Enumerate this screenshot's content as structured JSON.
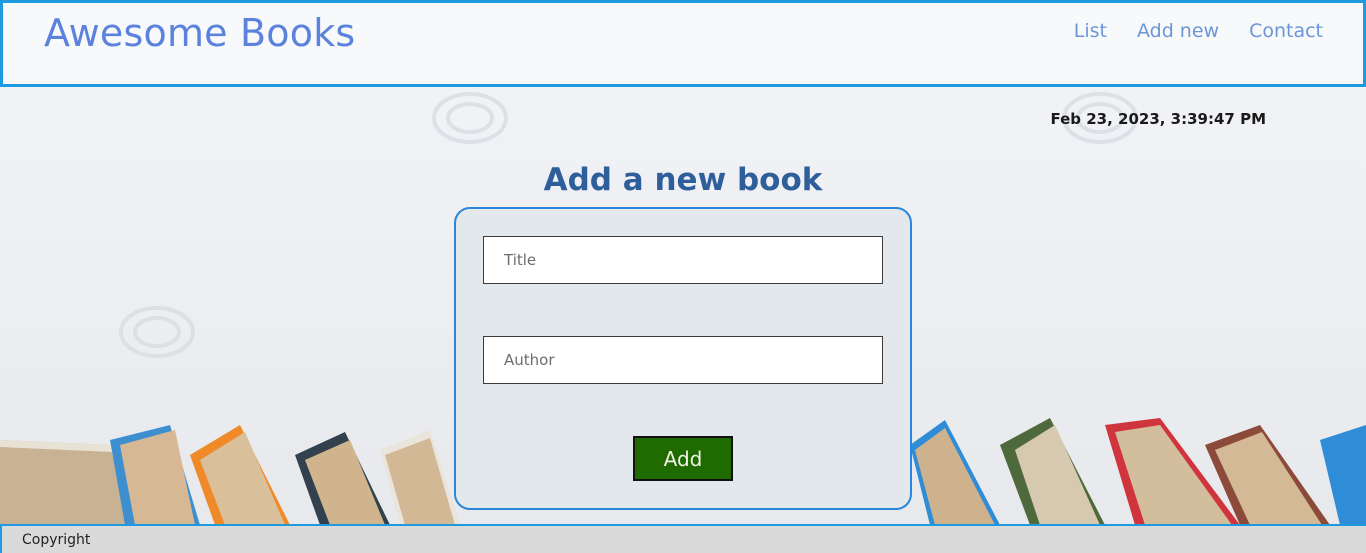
{
  "header": {
    "logo": "Awesome Books",
    "nav": [
      {
        "label": "List"
      },
      {
        "label": "Add new"
      },
      {
        "label": "Contact"
      }
    ]
  },
  "datetime": "Feb 23, 2023, 3:39:47 PM",
  "form": {
    "title": "Add a new book",
    "title_placeholder": "Title",
    "author_placeholder": "Author",
    "add_label": "Add"
  },
  "footer": {
    "copyright": "Copyright"
  },
  "colors": {
    "accent_border": "#1e9be0",
    "logo": "#5b82dc",
    "nav": "#6c96d8",
    "heading": "#2e5f9a",
    "button": "#1f6b00"
  }
}
